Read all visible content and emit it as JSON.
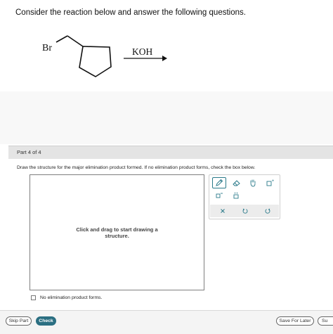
{
  "question": {
    "prompt": "Consider the reaction below and answer the following questions.",
    "substituent_label": "Br",
    "reagent": "KOH"
  },
  "part": {
    "label": "Part 4 of 4",
    "instruction": "Draw the structure for the major elimination product formed. If no elimination product forms, check the box below.",
    "canvas_hint_line1": "Click and drag to start drawing a",
    "canvas_hint_line2": "structure.",
    "checkbox_label": "No elimination product forms.",
    "checkbox_checked": false
  },
  "toolbar": {
    "icons": [
      "pencil-icon",
      "eraser-icon",
      "hand-icon",
      "template-icon",
      "charge-icon",
      "lone-pair-icon",
      "clear-icon",
      "undo-icon",
      "redo-icon"
    ],
    "accent_color": "#2a7a8a"
  },
  "footer": {
    "skip_label": "Skip Part",
    "check_label": "Check",
    "save_label": "Save For Later",
    "submit_label": "Su"
  }
}
